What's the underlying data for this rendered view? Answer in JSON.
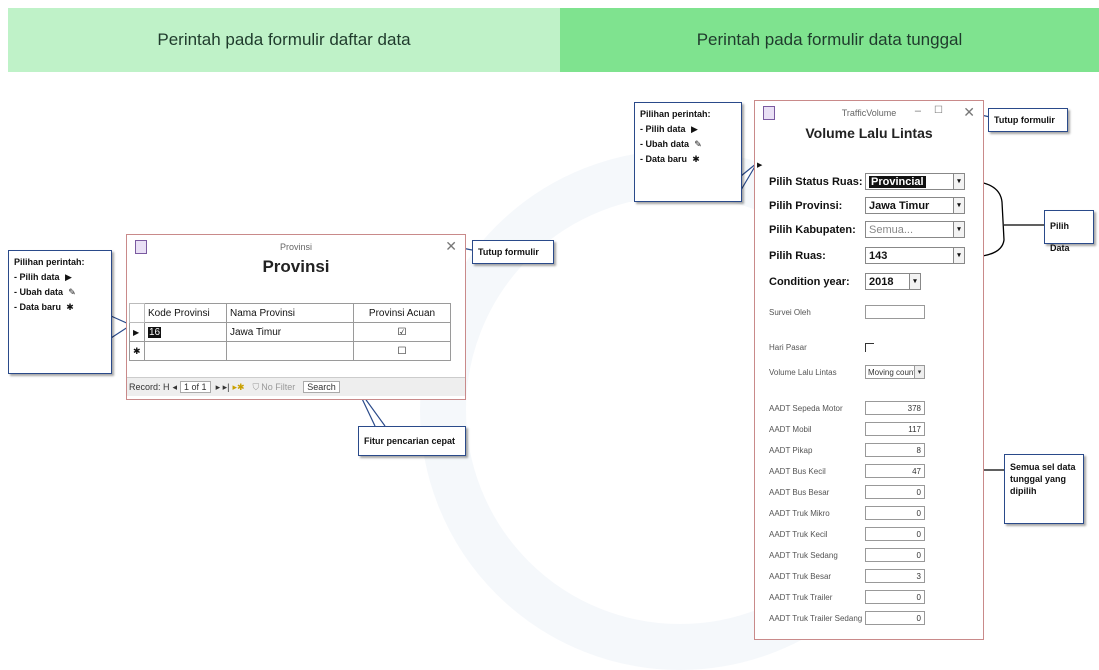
{
  "headers": {
    "left": "Perintah pada formulir daftar data",
    "right": "Perintah pada formulir data tunggal"
  },
  "callout_commands": {
    "title": "Pilihan perintah:",
    "items": [
      "- Pilih data",
      "- Ubah data",
      "- Data baru"
    ]
  },
  "labels": {
    "tutup_formulir": "Tutup formulir",
    "fitur_pencarian": "Fitur pencarian cepat",
    "pilih_data": "Pilih Data",
    "semua_sel": "Semua sel data tunggal yang dipilih"
  },
  "provinsi_form": {
    "window_title": "Provinsi",
    "form_title": "Provinsi",
    "columns": [
      "Kode Provinsi",
      "Nama Provinsi",
      "Provinsi Acuan"
    ],
    "rows": [
      {
        "kode": "16",
        "nama": "Jawa Timur",
        "acuan": "☑"
      },
      {
        "kode": "",
        "nama": "",
        "acuan": "☐"
      }
    ],
    "nav": {
      "record_label": "Record: H",
      "record_pos": "1 of 1",
      "no_filter": "No Filter",
      "search": "Search"
    }
  },
  "traffic_form": {
    "window_title": "TrafficVolume",
    "form_title": "Volume Lalu Lintas",
    "selectors": [
      {
        "label": "Pilih Status Ruas:",
        "value": "Provincial"
      },
      {
        "label": "Pilih Provinsi:",
        "value": "Jawa Timur"
      },
      {
        "label": "Pilih Kabupaten:",
        "value": "Semua..."
      },
      {
        "label": "Pilih Ruas:",
        "value": "143"
      }
    ],
    "condition_year": {
      "label": "Condition year:",
      "value": "2018"
    },
    "survei_oleh": {
      "label": "Survei Oleh",
      "value": ""
    },
    "hari_pasar": {
      "label": "Hari Pasar"
    },
    "volume_lalu_lintas": {
      "label": "Volume Lalu Lintas",
      "value": "Moving count"
    },
    "aadt": [
      {
        "label": "AADT Sepeda Motor",
        "value": "378"
      },
      {
        "label": "AADT Mobil",
        "value": "117"
      },
      {
        "label": "AADT Pikap",
        "value": "8"
      },
      {
        "label": "AADT Bus Kecil",
        "value": "47"
      },
      {
        "label": "AADT Bus Besar",
        "value": "0"
      },
      {
        "label": "AADT Truk Mikro",
        "value": "0"
      },
      {
        "label": "AADT Truk Kecil",
        "value": "0"
      },
      {
        "label": "AADT Truk Sedang",
        "value": "0"
      },
      {
        "label": "AADT Truk Besar",
        "value": "3"
      },
      {
        "label": "AADT Truk Trailer",
        "value": "0"
      },
      {
        "label": "AADT Truk Trailer Sedang",
        "value": "0"
      }
    ]
  },
  "colors": {
    "header_left": "#bff2c8",
    "header_right": "#7fe38f",
    "callout_border": "#2a4a8a"
  }
}
